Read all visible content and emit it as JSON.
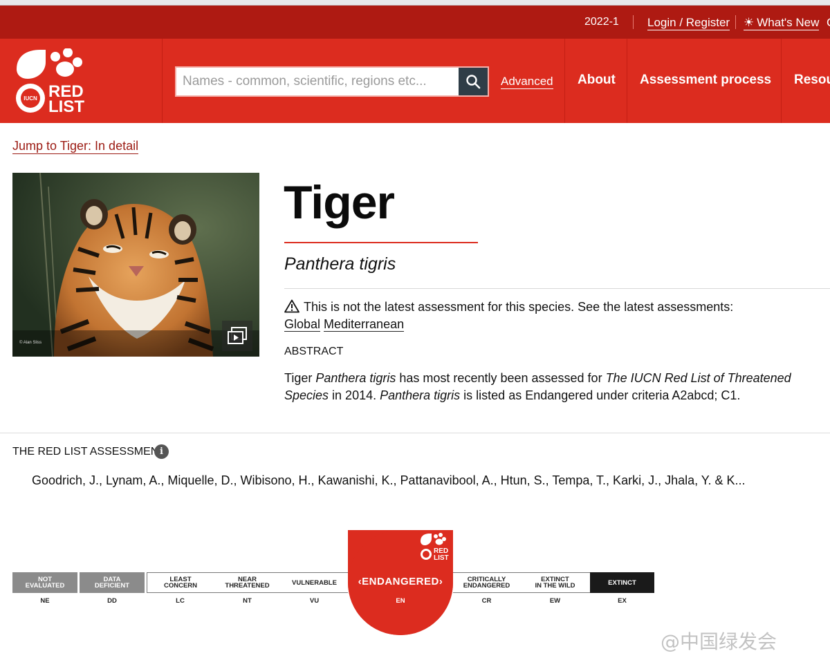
{
  "utility_bar": {
    "version": "2022-1",
    "login_label": "Login / Register",
    "whats_new_label": "What's New",
    "overflow_char": "C"
  },
  "header": {
    "logo_text_top": "RED",
    "logo_text_bottom": "LIST",
    "logo_badge": "IUCN",
    "search_placeholder": "Names - common, scientific, regions etc...",
    "advanced_label": "Advanced",
    "nav": [
      "About",
      "Assessment process",
      "Resou"
    ]
  },
  "jump_link": "Jump to Tiger: In detail",
  "photo": {
    "credit": "© Alan Sliss"
  },
  "species": {
    "common_name": "Tiger",
    "scientific_name": "Panthera tigris",
    "notice": "This is not the latest assessment for this species. See the latest assessments:",
    "regions": [
      "Global",
      "Mediterranean"
    ],
    "abstract_heading": "ABSTRACT",
    "abstract": {
      "part1": "Tiger ",
      "sci1": "Panthera tigris",
      "part2": " has most recently been assessed for ",
      "pub": "The IUCN Red List of Threatened Species",
      "part3": " in 2014. ",
      "sci2": "Panthera tigris",
      "part4": " is listed as Endangered under criteria A2abcd; C1."
    }
  },
  "assessment": {
    "heading": "THE RED LIST ASSESSMENT",
    "info_glyph": "i",
    "assessors": "Goodrich, J., Lynam, A., Miquelle, D., Wibisono, H., Kawanishi, K., Pattanavibool, A., Htun, S., Tempa, T., Karki, J., Jhala, Y. & K..."
  },
  "scale": {
    "categories": [
      {
        "label": "NOT\nEVALUATED",
        "code": "NE"
      },
      {
        "label": "DATA\nDEFICIENT",
        "code": "DD"
      },
      {
        "label": "LEAST\nCONCERN",
        "code": "LC"
      },
      {
        "label": "NEAR\nTHREATENED",
        "code": "NT"
      },
      {
        "label": "VULNERABLE",
        "code": "VU"
      },
      {
        "label": "ENDANGERED",
        "code": "EN"
      },
      {
        "label": "CRITICALLY\nENDANGERED",
        "code": "CR"
      },
      {
        "label": "EXTINCT\nIN THE WILD",
        "code": "EW"
      },
      {
        "label": "EXTINCT",
        "code": "EX"
      }
    ],
    "selected_label": "ENDANGERED",
    "selected_code": "EN"
  },
  "watermark": "@中国绿发会",
  "colors": {
    "brand_red": "#dc2c1f",
    "utility_red": "#ae1a12",
    "search_button": "#2f3d47",
    "category_grey": "#8b8b8b",
    "extinct_black": "#1a1a1a"
  }
}
